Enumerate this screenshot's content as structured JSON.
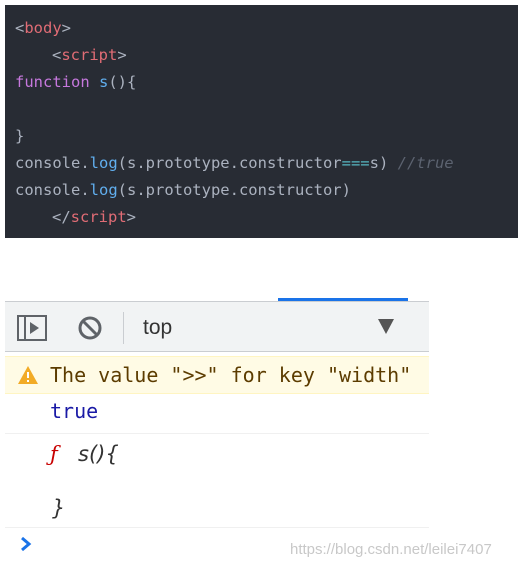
{
  "code": {
    "line1": {
      "open": "<",
      "tag": "body",
      "close": ">"
    },
    "line2": {
      "open": "<",
      "tag": "script",
      "close": ">"
    },
    "line3": {
      "keyword": "function",
      "space": " ",
      "name": "s",
      "rest": "(){"
    },
    "line5": {
      "text": "}"
    },
    "line6": {
      "obj": "console.",
      "method": "log",
      "args": "(s.prototype.constructor",
      "op": "===",
      "tail": "s) ",
      "comment": "//true"
    },
    "line7": {
      "obj": "console.",
      "method": "log",
      "args": "(s.prototype.constructor)"
    },
    "line8": {
      "open": "</",
      "tag": "script",
      "close": ">"
    }
  },
  "devtools": {
    "toolbar": {
      "sidebar_icon": "sidebar-toggle-icon",
      "clear_icon": "clear-console-icon",
      "context_value": "top"
    },
    "messages": {
      "warning_text": "The value \">>\" for key \"width\"",
      "true_value": "true",
      "fn_prefix": "ƒ",
      "fn_signature": "s(){",
      "fn_close": "}"
    },
    "prompt_icon": "prompt-chevron-icon"
  },
  "watermark": "https://blog.csdn.net/leilei7407",
  "colors": {
    "code_bg": "#282c34",
    "tag": "#e06c75",
    "keyword": "#c678dd",
    "function": "#61afef",
    "operator": "#56b6c2",
    "comment": "#5c6370",
    "warning_bg": "#fffbe5",
    "boolean": "#1a1aa6",
    "accent": "#1a73e8"
  }
}
